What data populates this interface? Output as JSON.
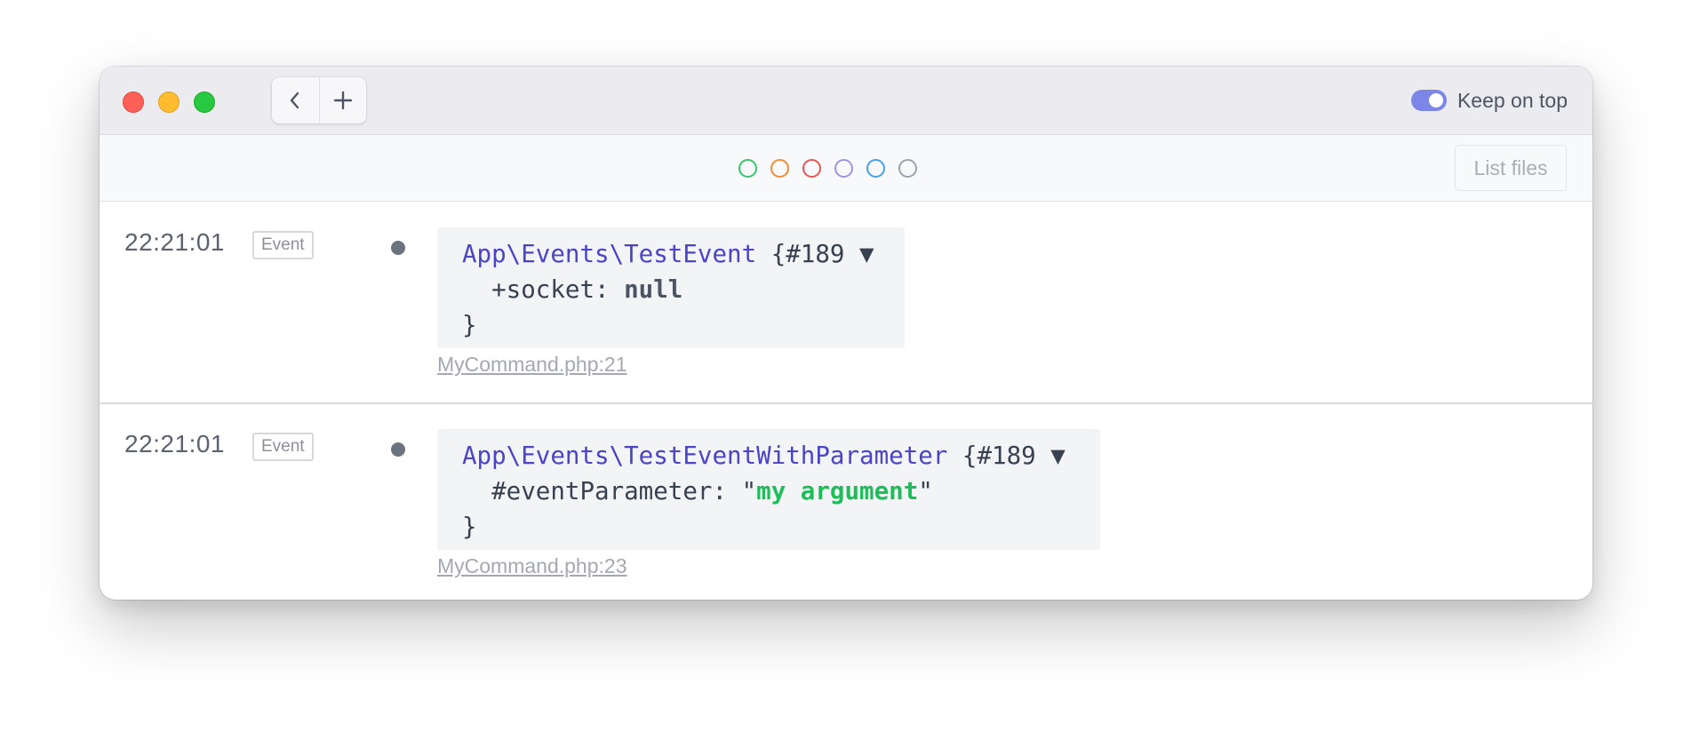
{
  "window": {
    "controls": [
      "close",
      "minimize",
      "zoom"
    ],
    "nav": {
      "back_icon": "chevron-left-icon",
      "new_icon": "plus-icon"
    },
    "keep_on_top": {
      "label": "Keep on top",
      "enabled": true,
      "accent_color": "#7c86e6"
    }
  },
  "filters": {
    "colors": [
      {
        "name": "green",
        "color": "#3cc46d"
      },
      {
        "name": "orange",
        "color": "#f08c3a"
      },
      {
        "name": "red",
        "color": "#e45757"
      },
      {
        "name": "purple",
        "color": "#a394e0"
      },
      {
        "name": "blue",
        "color": "#4a9fe8"
      },
      {
        "name": "gray",
        "color": "#9ca3af"
      }
    ],
    "list_files_label": "List files"
  },
  "entries": [
    {
      "time": "22:21:01",
      "type": "Event",
      "dump": {
        "class_name": "App\\Events\\TestEvent",
        "object_ref": " {#189 ",
        "caret": "▼",
        "property": "  +socket: ",
        "value": "null",
        "close": "}"
      },
      "source": "MyCommand.php:21"
    },
    {
      "time": "22:21:01",
      "type": "Event",
      "dump": {
        "class_name": "App\\Events\\TestEventWithParameter",
        "object_ref": " {#189 ",
        "caret": "▼",
        "property": "  #eventParameter: ",
        "quote_open": "\"",
        "value": "my argument",
        "quote_close": "\"",
        "close": "}"
      },
      "source": "MyCommand.php:23"
    }
  ]
}
